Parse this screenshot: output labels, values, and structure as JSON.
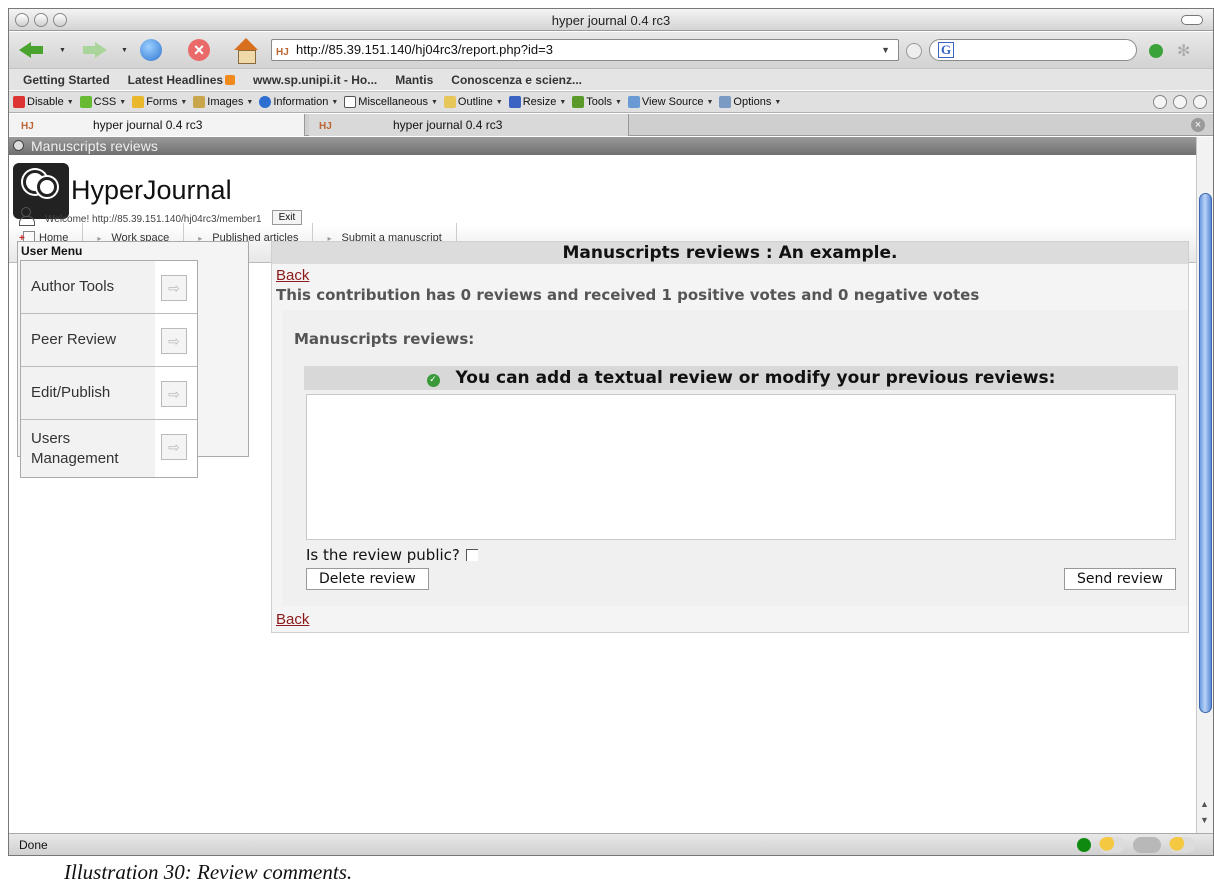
{
  "window": {
    "title": "hyper journal 0.4 rc3"
  },
  "toolbar": {
    "url": "http://85.39.151.140/hj04rc3/report.php?id=3",
    "search_engine_icon": "G"
  },
  "bookmarks": [
    "Getting Started",
    "Latest Headlines",
    "www.sp.unipi.it - Ho...",
    "Mantis",
    "Conoscenza e scienz..."
  ],
  "devtools": [
    "Disable",
    "CSS",
    "Forms",
    "Images",
    "Information",
    "Miscellaneous",
    "Outline",
    "Resize",
    "Tools",
    "View Source",
    "Options"
  ],
  "tabs": [
    "hyper journal 0.4 rc3",
    "hyper journal 0.4 rc3"
  ],
  "page": {
    "top_bar_title": "Manuscripts reviews",
    "brand": "HyperJournal",
    "nav": [
      "Home",
      "Work space",
      "Published articles",
      "Submit a manuscript"
    ],
    "welcome": "Welcome! http://85.39.151.140/hj04rc3/member1",
    "exit_label": "Exit"
  },
  "user_menu": {
    "title": "User Menu",
    "items": [
      "Author Tools",
      "Peer Review",
      "Edit/Publish",
      "Users Management"
    ]
  },
  "content": {
    "title": "Manuscripts reviews : An example.",
    "back_label": "Back",
    "summary": "This contribution has 0 reviews and received 1 positive votes and 0 negative votes",
    "reviews_heading": "Manuscripts reviews:",
    "add_review_prompt": "You can add a textual review or modify your previous reviews:",
    "review_text": "",
    "public_label": "Is the review public?",
    "public_checked": false,
    "delete_label": "Delete review",
    "send_label": "Send review"
  },
  "status": {
    "text": "Done"
  },
  "caption": "Illustration 30: Review comments."
}
